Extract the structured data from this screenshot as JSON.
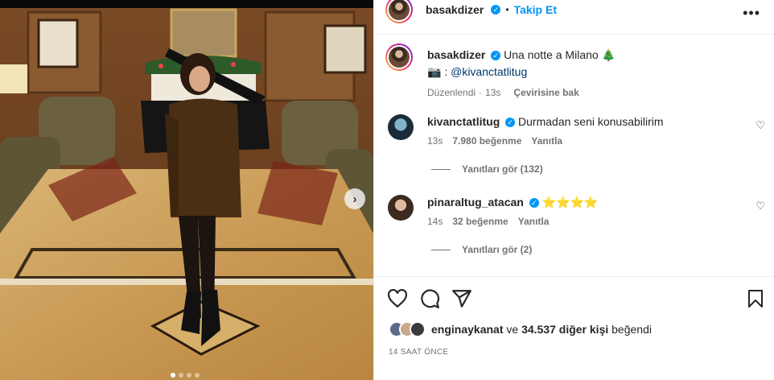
{
  "post": {
    "author": "basakdizer",
    "follow_label": "Takip Et",
    "bullet": "•",
    "more_label": "•••",
    "caption_text": "Una notte a Milano 🎄",
    "caption_camera": "📷 : ",
    "caption_mention": "@kivanctatlitug",
    "caption_edited": "Düzenlendi",
    "caption_time": "13s",
    "caption_translate": "Çevirisine bak",
    "next_label": "›"
  },
  "comments": [
    {
      "user": "kivanctatlitug",
      "text": "Durmadan seni konusabilirim",
      "time": "13s",
      "likes": "7.980 beğenme",
      "reply": "Yanıtla",
      "view_replies": "Yanıtları gör (132)"
    },
    {
      "user": "pinaraltug_atacan",
      "text": "⭐⭐⭐⭐",
      "time": "14s",
      "likes": "32 beğenme",
      "reply": "Yanıtla",
      "view_replies": "Yanıtları gör (2)"
    }
  ],
  "likes_bar": {
    "user": "enginaykanat",
    "connector": " ve ",
    "others": "34.537 diğer kişi",
    "suffix": " beğendi"
  },
  "timestamp": "14 SAAT ÖNCE",
  "icons": [
    "heart-icon",
    "comment-icon",
    "share-icon",
    "bookmark-icon",
    "more-icon",
    "verified-icon",
    "next-arrow-icon"
  ],
  "colors": {
    "accent": "#0095f6",
    "text": "#262626",
    "muted": "#737373",
    "mention": "#00376b"
  }
}
